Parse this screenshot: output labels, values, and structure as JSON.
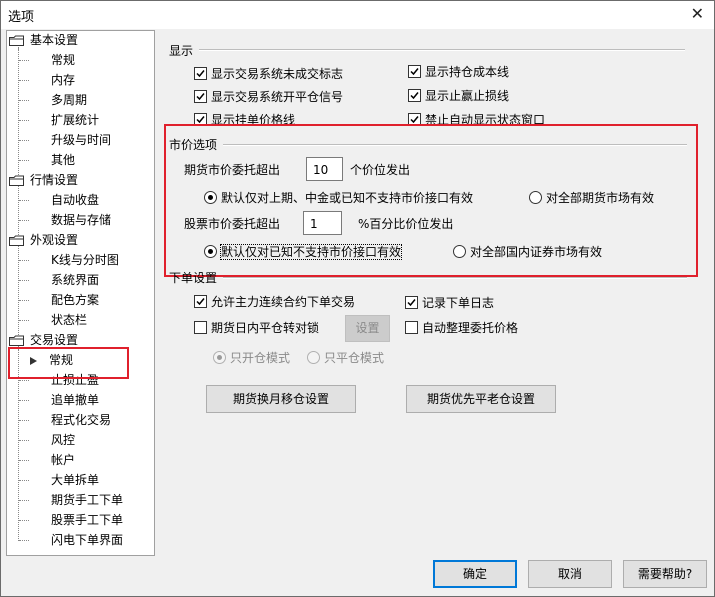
{
  "window": {
    "title": "选项",
    "close_glyph": "✕"
  },
  "tree": {
    "groups": [
      {
        "label": "基本设置",
        "children": [
          "常规",
          "内存",
          "多周期",
          "扩展统计",
          "升级与时间",
          "其他"
        ]
      },
      {
        "label": "行情设置",
        "children": [
          "自动收盘",
          "数据与存储"
        ]
      },
      {
        "label": "外观设置",
        "children": [
          "K线与分时图",
          "系统界面",
          "配色方案",
          "状态栏"
        ]
      },
      {
        "label": "交易设置",
        "children": [
          "常规",
          "止损止盈",
          "追单撤单",
          "程式化交易",
          "风控",
          "帐户",
          "大单拆单",
          "期货手工下单",
          "股票手工下单",
          "闪电下单界面"
        ]
      }
    ],
    "selected": "常规"
  },
  "display": {
    "header": "显示",
    "left": [
      {
        "label": "显示交易系统未成交标志",
        "checked": true
      },
      {
        "label": "显示交易系统开平仓信号",
        "checked": true
      },
      {
        "label": "显示挂单价格线",
        "checked": true
      }
    ],
    "right": [
      {
        "label": "显示持仓成本线",
        "checked": true
      },
      {
        "label": "显示止赢止损线",
        "checked": true
      },
      {
        "label": "禁止自动显示状态窗口",
        "checked": true
      }
    ]
  },
  "market": {
    "header": "市价选项",
    "futures_label": "期货市价委托超出",
    "futures_value": "10",
    "futures_suffix": "个价位发出",
    "futures_opt1": "默认仅对上期、中金或已知不支持市价接口有效",
    "futures_opt2": "对全部期货市场有效",
    "stock_label": "股票市价委托超出",
    "stock_value": "1",
    "stock_suffix": "%百分比价位发出",
    "stock_opt1": "默认仅对已知不支持市价接口有效",
    "stock_opt2": "对全部国内证券市场有效"
  },
  "order": {
    "header": "下单设置",
    "main_contract": "允许主力连续合约下单交易",
    "log": "记录下单日志",
    "lock": "期货日内平仓转对锁",
    "settings_btn": "设置",
    "auto_adjust": "自动整理委托价格",
    "mode1": "只开仓模式",
    "mode2": "只平仓模式",
    "month_move_btn": "期货换月移仓设置",
    "priority_btn": "期货优先平老仓设置"
  },
  "buttons": {
    "ok": "确定",
    "cancel": "取消",
    "help": "需要帮助?"
  },
  "colors": {
    "highlight": "#e0202c",
    "accent": "#0078d7"
  }
}
